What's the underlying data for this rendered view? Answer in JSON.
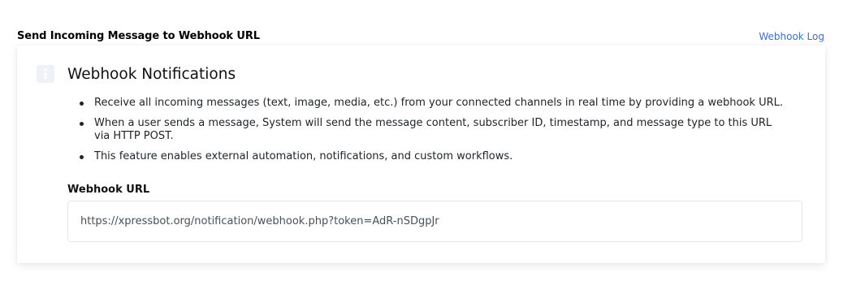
{
  "header": {
    "title": "Send Incoming Message to Webhook URL",
    "log_link": "Webhook Log"
  },
  "card": {
    "icon": "info-icon",
    "title": "Webhook Notifications",
    "bullets": [
      "Receive all incoming messages (text, image, media, etc.) from your connected channels in real time by providing a webhook URL.",
      "When a user sends a message, System will send the message content, subscriber ID, timestamp, and message type to this URL via HTTP POST.",
      "This feature enables external automation, notifications, and custom workflows."
    ],
    "url_field": {
      "label": "Webhook URL",
      "value": "https://xpressbot.org/notification/webhook.php?token=AdR-nSDgpJr"
    }
  },
  "colors": {
    "link": "#3b6fd6",
    "icon_background": "#eef1f7"
  }
}
